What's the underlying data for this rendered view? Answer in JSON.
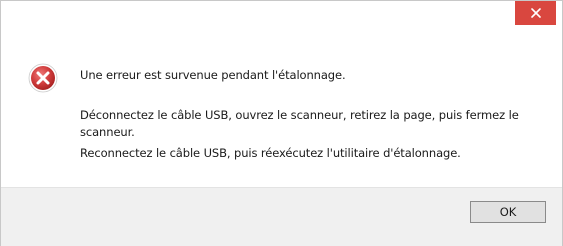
{
  "dialog": {
    "close_icon": "close-icon",
    "icon": "error-icon",
    "messages": [
      "Une erreur est survenue pendant l'étalonnage.",
      "Déconnectez le câble USB, ouvrez le scanneur, retirez la page, puis fermez le scanneur.",
      "Reconnectez le câble USB, puis réexécutez l'utilitaire d'étalonnage."
    ],
    "ok_label": "OK"
  },
  "colors": {
    "close_button": "#d9473f",
    "error_icon": "#d03c3c",
    "footer_bg": "#f0f0f0"
  }
}
